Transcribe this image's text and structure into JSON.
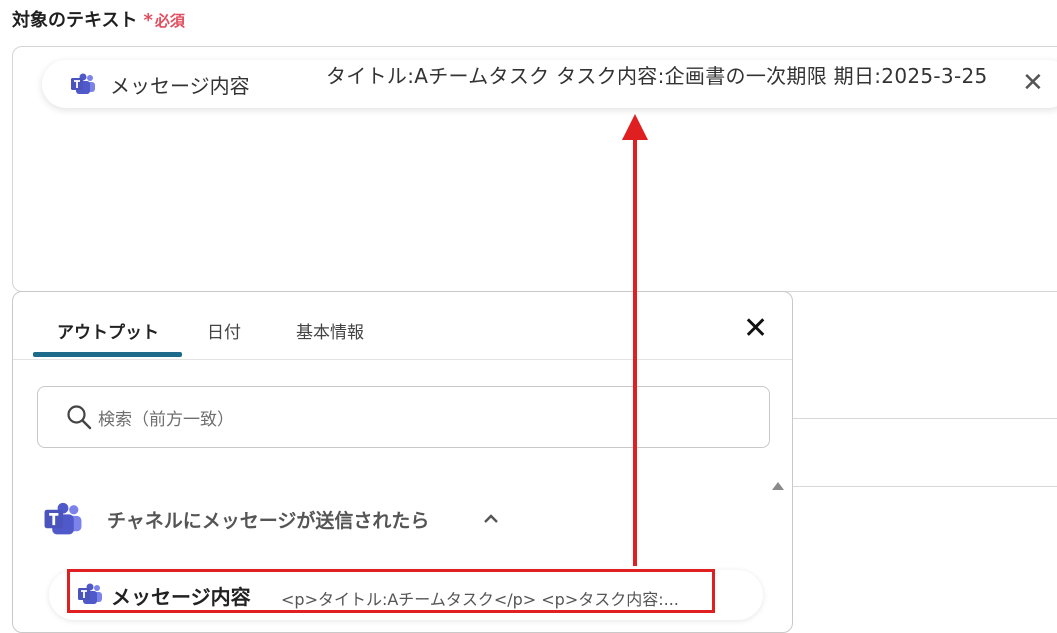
{
  "field": {
    "label": "対象のテキスト",
    "required_mark": "*",
    "required_text": "必須"
  },
  "chip": {
    "label": "メッセージ内容",
    "value": "タイトル:Aチームタスク タスク内容:企画書の一次期限 期日:2025-3-25",
    "close_glyph": "✕",
    "icon": "teams-icon"
  },
  "popup": {
    "tabs": [
      {
        "label": "アウトプット",
        "active": true
      },
      {
        "label": "日付",
        "active": false
      },
      {
        "label": "基本情報",
        "active": false
      }
    ],
    "close_glyph": "✕",
    "search": {
      "placeholder": "検索（前方一致）",
      "value": ""
    },
    "section": {
      "title": "チャネルにメッセージが送信されたら",
      "icon": "teams-icon",
      "expanded": true
    },
    "items": [
      {
        "label": "メッセージ内容",
        "preview": "<p>タイトル:Aチームタスク</p> <p>タスク内容:...",
        "icon": "teams-icon"
      }
    ]
  },
  "annotation": {
    "color": "#e02020"
  },
  "colors": {
    "accent_tab": "#1d6a8a",
    "required": "#e24d5f",
    "teams_purple": "#5059c9"
  }
}
